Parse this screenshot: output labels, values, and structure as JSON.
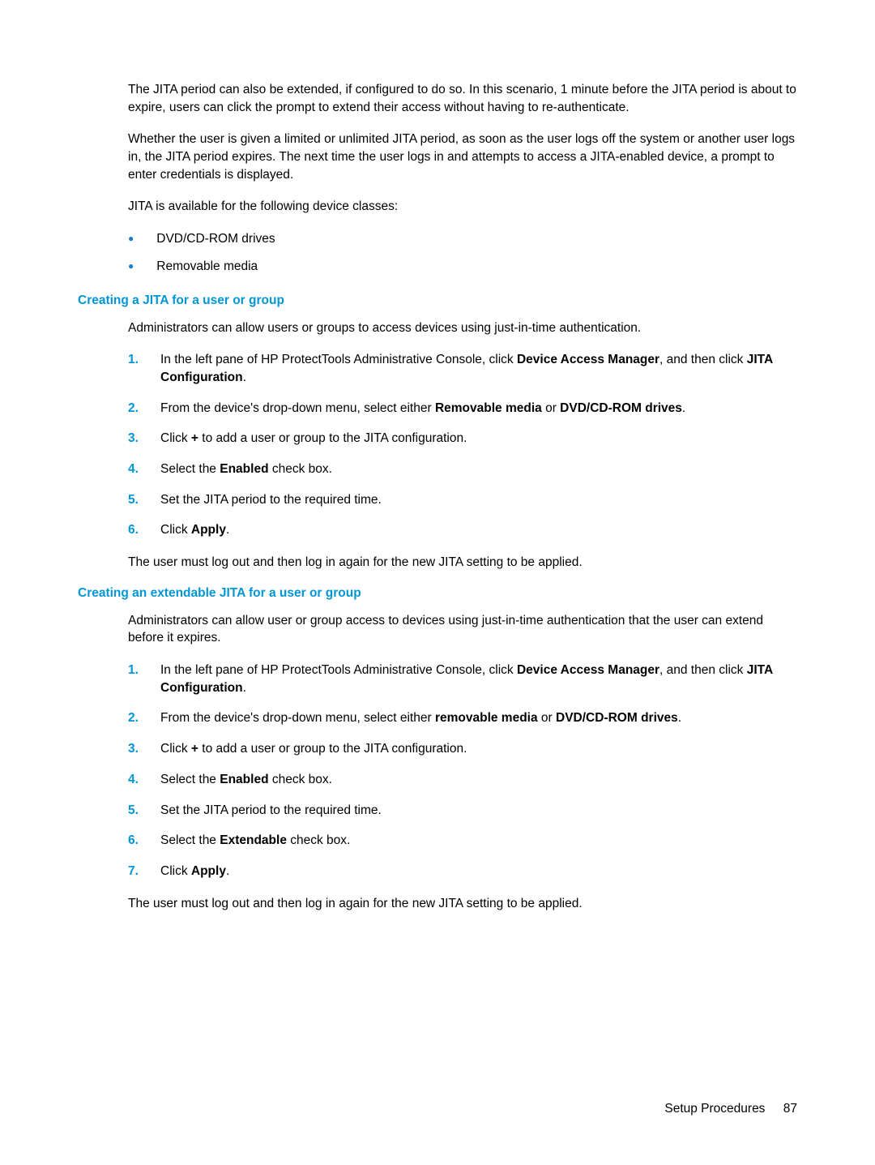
{
  "intro": {
    "p1": "The JITA period can also be extended, if configured to do so. In this scenario, 1 minute before the JITA period is about to expire, users can click the prompt to extend their access without having to re-authenticate.",
    "p2": "Whether the user is given a limited or unlimited JITA period, as soon as the user logs off the system or another user logs in, the JITA period expires. The next time the user logs in and attempts to access a JITA-enabled device, a prompt to enter credentials is displayed.",
    "p3": "JITA is available for the following device classes:",
    "bullets": [
      "DVD/CD-ROM drives",
      "Removable media"
    ]
  },
  "section1": {
    "heading": "Creating a JITA for a user or group",
    "p1": "Administrators can allow users or groups to access devices using just-in-time authentication.",
    "steps": [
      {
        "pre": "In the left pane of HP ProtectTools Administrative Console, click ",
        "b1": "Device Access Manager",
        "mid": ", and then click ",
        "b2": "JITA Configuration",
        "post": "."
      },
      {
        "pre": "From the device's drop-down menu, select either ",
        "b1": "Removable media",
        "mid": " or ",
        "b2": "DVD/CD-ROM drives",
        "post": "."
      },
      {
        "pre": "Click ",
        "b1": "+",
        "mid": " to add a user or group to the JITA configuration.",
        "b2": "",
        "post": ""
      },
      {
        "pre": "Select the ",
        "b1": "Enabled",
        "mid": " check box.",
        "b2": "",
        "post": ""
      },
      {
        "pre": "Set the JITA period to the required time.",
        "b1": "",
        "mid": "",
        "b2": "",
        "post": ""
      },
      {
        "pre": "Click ",
        "b1": "Apply",
        "mid": ".",
        "b2": "",
        "post": ""
      }
    ],
    "p2": "The user must log out and then log in again for the new JITA setting to be applied."
  },
  "section2": {
    "heading": "Creating an extendable JITA for a user or group",
    "p1": "Administrators can allow user or group access to devices using just-in-time authentication that the user can extend before it expires.",
    "steps": [
      {
        "pre": "In the left pane of HP ProtectTools Administrative Console, click ",
        "b1": "Device Access Manager",
        "mid": ", and then click ",
        "b2": "JITA Configuration",
        "post": "."
      },
      {
        "pre": "From the device's drop-down menu, select either ",
        "b1": "removable media",
        "mid": " or ",
        "b2": "DVD/CD-ROM drives",
        "post": "."
      },
      {
        "pre": "Click ",
        "b1": "+",
        "mid": " to add a user or group to the JITA configuration.",
        "b2": "",
        "post": ""
      },
      {
        "pre": "Select the ",
        "b1": "Enabled",
        "mid": " check box.",
        "b2": "",
        "post": ""
      },
      {
        "pre": "Set the JITA period to the required time.",
        "b1": "",
        "mid": "",
        "b2": "",
        "post": ""
      },
      {
        "pre": "Select the ",
        "b1": "Extendable",
        "mid": " check box.",
        "b2": "",
        "post": ""
      },
      {
        "pre": "Click ",
        "b1": "Apply",
        "mid": ".",
        "b2": "",
        "post": ""
      }
    ],
    "p2": "The user must log out and then log in again for the new JITA setting to be applied."
  },
  "footer": {
    "section": "Setup Procedures",
    "page": "87"
  }
}
